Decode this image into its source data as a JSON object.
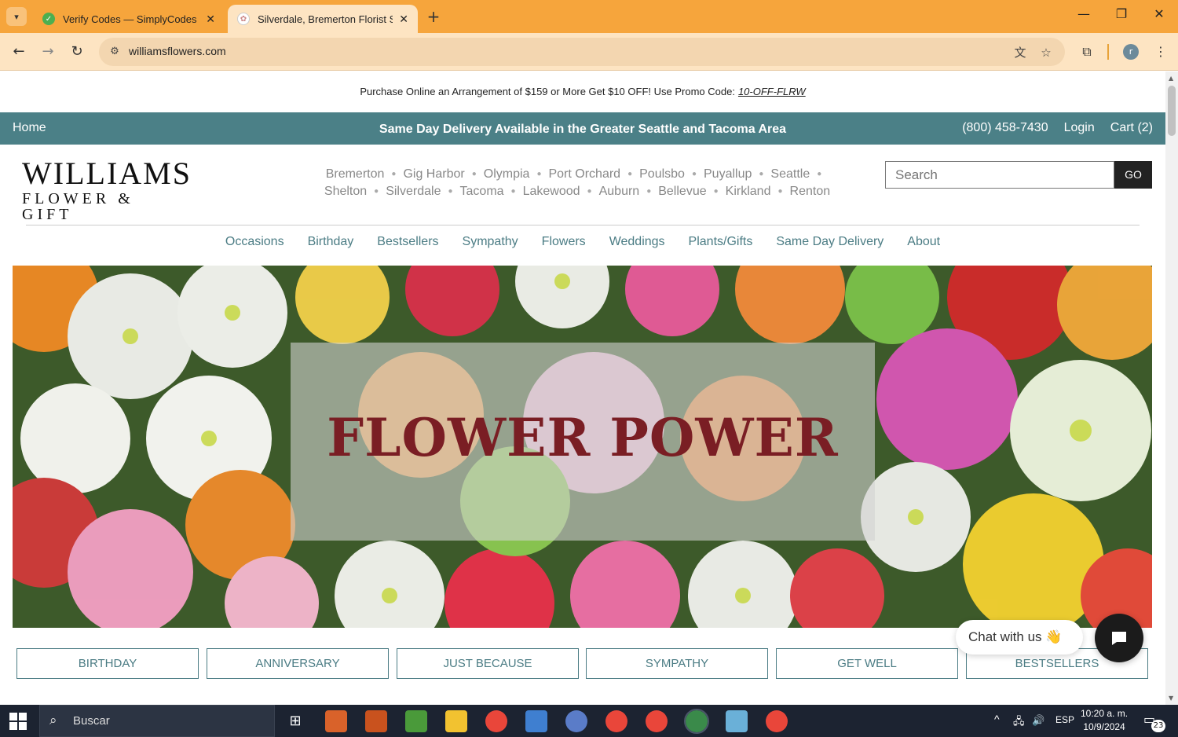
{
  "browser": {
    "tabs": [
      {
        "title": "Verify Codes — SimplyCodes"
      },
      {
        "title": "Silverdale, Bremerton Florist Sh"
      }
    ],
    "url": "williamsflowers.com",
    "avatar_letter": "r"
  },
  "promo": {
    "text": "Purchase Online an Arrangement of $159 or More Get $10 OFF! Use Promo Code:",
    "code": "10-OFF-FLRW"
  },
  "topbar": {
    "home": "Home",
    "headline": "Same Day Delivery Available in the Greater Seattle and Tacoma Area",
    "phone": "(800) 458-7430",
    "login": "Login",
    "cart": "Cart (2)"
  },
  "logo": {
    "line1": "WILLIAMS",
    "line2": "FLOWER & GIFT"
  },
  "cities": {
    "row1": [
      "Bremerton",
      "Gig Harbor",
      "Olympia",
      "Port Orchard",
      "Poulsbo",
      "Puyallup",
      "Seattle"
    ],
    "row2": [
      "Shelton",
      "Silverdale",
      "Tacoma",
      "Lakewood",
      "Auburn",
      "Bellevue",
      "Kirkland",
      "Renton"
    ]
  },
  "search": {
    "placeholder": "Search",
    "button": "GO"
  },
  "nav": [
    "Occasions",
    "Birthday",
    "Bestsellers",
    "Sympathy",
    "Flowers",
    "Weddings",
    "Plants/Gifts",
    "Same Day Delivery",
    "About"
  ],
  "hero": {
    "title": "FLOWER POWER"
  },
  "categories": [
    "BIRTHDAY",
    "ANNIVERSARY",
    "JUST BECAUSE",
    "SYMPATHY",
    "GET WELL",
    "BESTSELLERS"
  ],
  "chat": {
    "label": "Chat with us",
    "emoji": "👋"
  },
  "taskbar": {
    "search_label": "Buscar",
    "lang": "ESP",
    "time": "10:20 a. m.",
    "date": "10/9/2024",
    "notifications": "23"
  },
  "colors": {
    "tabbar": "#f6a53c",
    "teal": "#4b8087",
    "hero_title": "#7a1e24",
    "nav_text": "#4b7c84"
  }
}
